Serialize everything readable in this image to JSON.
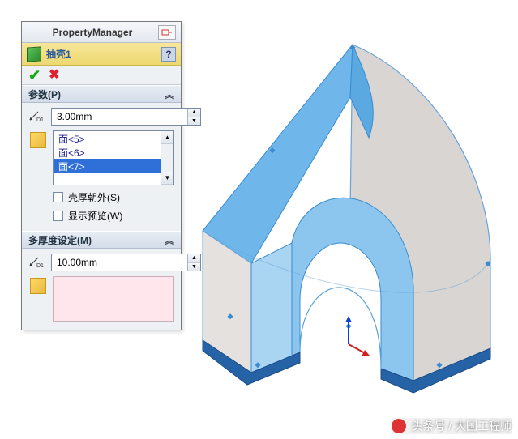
{
  "panel": {
    "title": "PropertyManager",
    "feature_name": "抽壳1",
    "help": "?"
  },
  "params": {
    "header": "参数(P)",
    "thickness": "3.00mm",
    "faces": [
      "面<5>",
      "面<6>",
      "面<7>"
    ],
    "selected_index": 2,
    "shell_outward": "壳厚朝外(S)",
    "show_preview": "显示预览(W)"
  },
  "multi": {
    "header": "多厚度设定(M)",
    "thickness": "10.00mm"
  },
  "watermark": "头条号 / 大国工程师"
}
